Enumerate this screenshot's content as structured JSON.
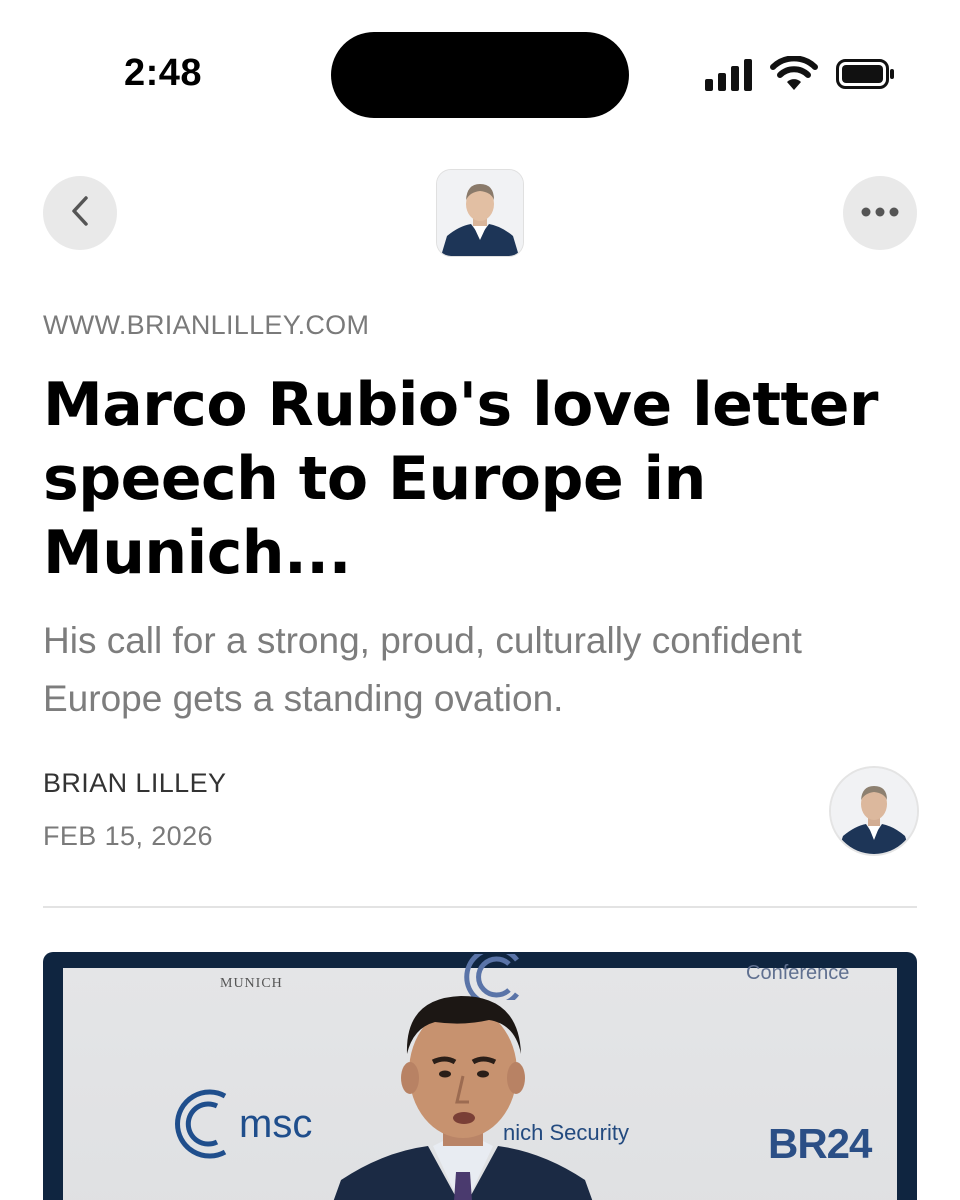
{
  "status": {
    "time": "2:48"
  },
  "nav": {
    "back_icon": "chevron-left-icon",
    "more_icon": "ellipsis-icon"
  },
  "article": {
    "source": "WWW.BRIANLILLEY.COM",
    "title": "Marco Rubio's love letter speech to Europe in Munich...",
    "subtitle": "His call for a strong, proud, culturally confident Europe gets a standing ovation.",
    "author": "BRIAN LILLEY",
    "date": "FEB 15, 2026"
  },
  "hero": {
    "backdrop_left_top": "MUNICH",
    "backdrop_right_top": "Conference",
    "msc_logo": "msc",
    "security_text": "nich Security",
    "br_logo": "BR24"
  },
  "colors": {
    "frame": "#0f2540",
    "msc_blue": "#1f4e8c",
    "button_bg": "#e9e9e9"
  }
}
